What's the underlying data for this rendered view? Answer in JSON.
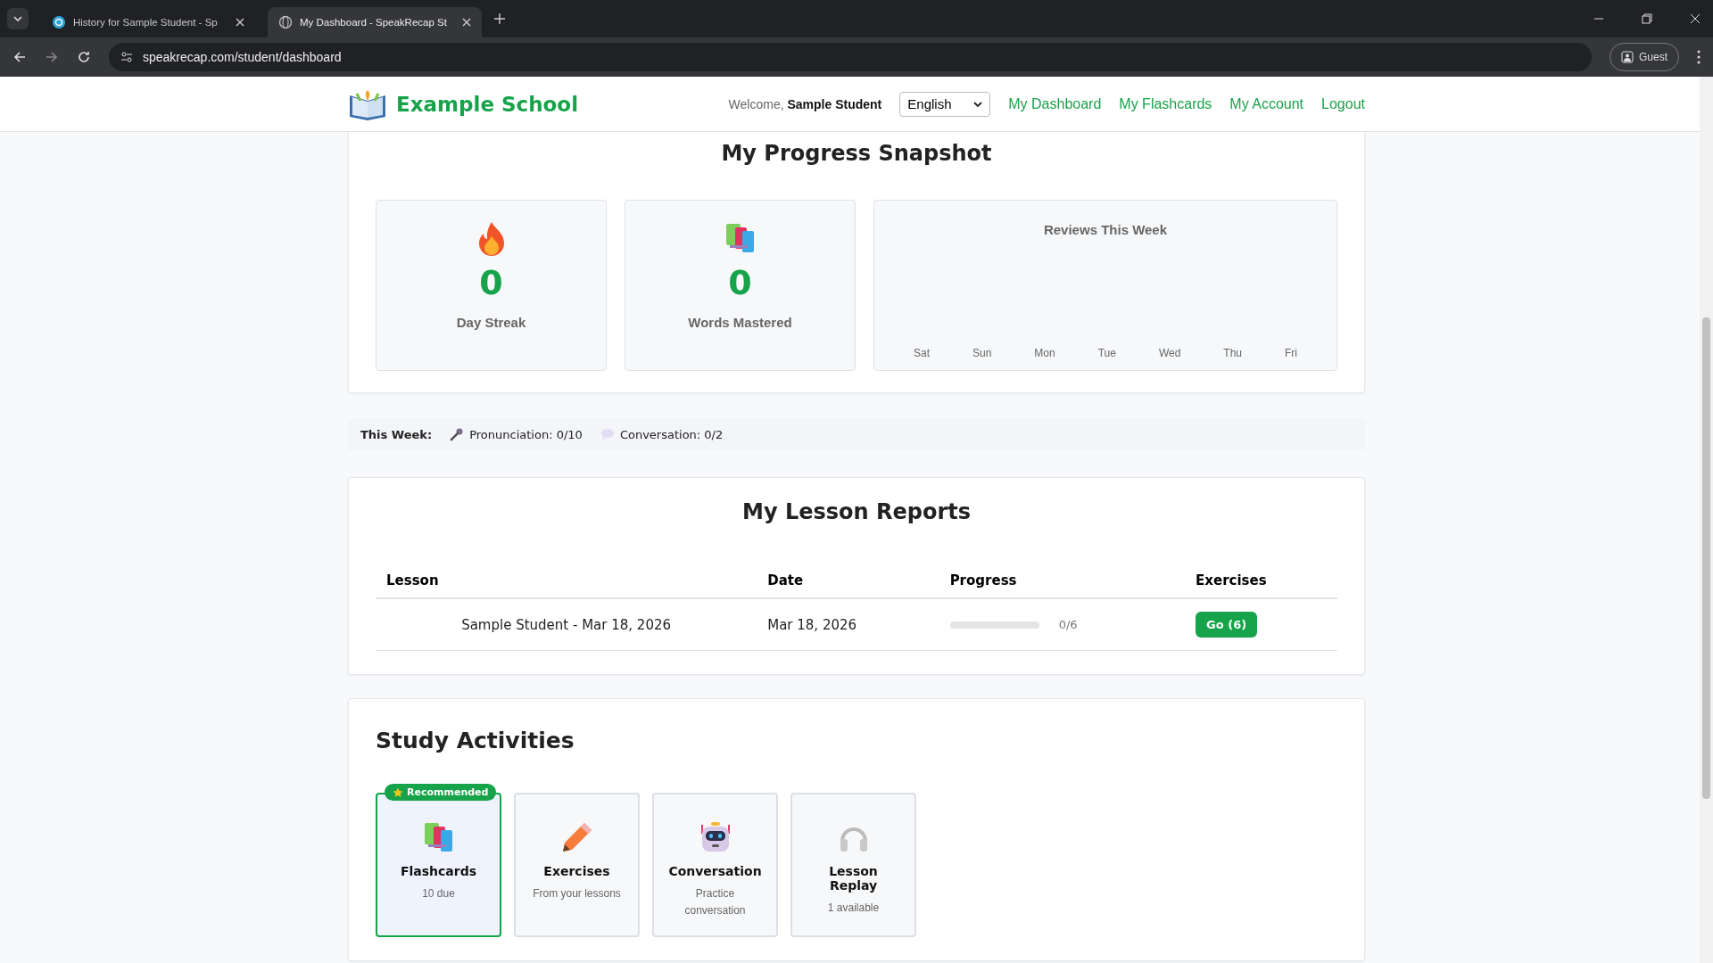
{
  "browser": {
    "tabs": [
      {
        "title": "History for Sample Student - Sp",
        "selected": false
      },
      {
        "title": "My Dashboard - SpeakRecap St",
        "selected": true
      }
    ],
    "url": "speakrecap.com/student/dashboard",
    "profile": "Guest"
  },
  "header": {
    "school": "Example School",
    "welcome": "Welcome,",
    "user": "Sample Student",
    "language": "English",
    "nav": [
      {
        "label": "My Dashboard"
      },
      {
        "label": "My Flashcards"
      },
      {
        "label": "My Account"
      },
      {
        "label": "Logout"
      }
    ]
  },
  "snapshot": {
    "title": "My Progress Snapshot",
    "stats": [
      {
        "kind": "streak",
        "value": "0",
        "label": "Day Streak"
      },
      {
        "kind": "words",
        "value": "0",
        "label": "Words Mastered"
      }
    ],
    "chart": {
      "title": "Reviews This Week",
      "days": [
        "Sat",
        "Sun",
        "Mon",
        "Tue",
        "Wed",
        "Thu",
        "Fri"
      ]
    }
  },
  "this_week": {
    "label": "This Week:",
    "items": [
      {
        "kind": "pronunciation",
        "text": "Pronunciation: 0/10"
      },
      {
        "kind": "conversation",
        "text": "Conversation: 0/2"
      }
    ]
  },
  "lessons": {
    "title": "My Lesson Reports",
    "columns": [
      "Lesson",
      "Date",
      "Progress",
      "Exercises"
    ],
    "rows": [
      {
        "lesson": "Sample Student - Mar 18, 2026",
        "date": "Mar 18, 2026",
        "level": 0,
        "progress": "0/6",
        "action": "Go (6)"
      }
    ]
  },
  "study": {
    "title": "Study Activities",
    "badge": "Recommended",
    "activities": [
      {
        "kind": "flashcards",
        "title": "Flashcards",
        "subtitle": "10 due",
        "recommended": true
      },
      {
        "kind": "exercises",
        "title": "Exercises",
        "subtitle": "From your lessons",
        "recommended": false
      },
      {
        "kind": "conversation",
        "title": "Conversation",
        "subtitle": "Practice conversation",
        "recommended": false
      },
      {
        "kind": "replay",
        "title": "Lesson Replay",
        "subtitle": "1 available",
        "recommended": false
      }
    ]
  }
}
